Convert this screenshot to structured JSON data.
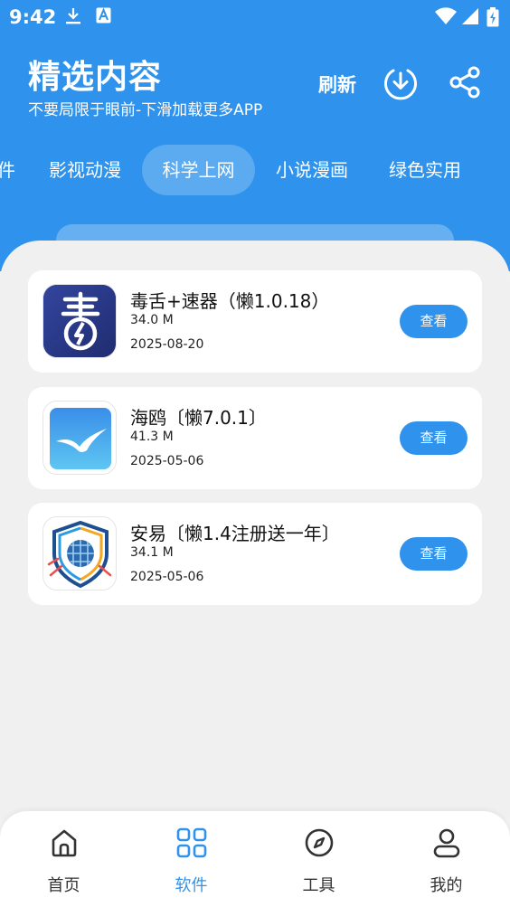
{
  "status_bar": {
    "time": "9:42"
  },
  "header": {
    "title": "精选内容",
    "subtitle": "不要局限于眼前-下滑加载更多APP",
    "refresh_label": "刷新"
  },
  "tabs": [
    {
      "label": "件"
    },
    {
      "label": "影视动漫"
    },
    {
      "label": "科学上网",
      "active": true
    },
    {
      "label": "小说漫画"
    },
    {
      "label": "绿色实用"
    }
  ],
  "apps": [
    {
      "name": "毒舌+速器（懒1.0.18）",
      "size": "34.0 M",
      "date": "2025-08-20",
      "button": "查看",
      "icon": "dushe-logo-icon"
    },
    {
      "name": "海鸥〔懒7.0.1〕",
      "size": "41.3 M",
      "date": "2025-05-06",
      "button": "查看",
      "icon": "seagull-icon"
    },
    {
      "name": "安易〔懒1.4注册送一年〕",
      "size": "34.1 M",
      "date": "2025-05-06",
      "button": "查看",
      "icon": "shield-globe-icon"
    }
  ],
  "bottom_nav": [
    {
      "label": "首页",
      "icon": "home-icon"
    },
    {
      "label": "软件",
      "icon": "grid-icon",
      "active": true
    },
    {
      "label": "工具",
      "icon": "compass-icon"
    },
    {
      "label": "我的",
      "icon": "user-icon"
    }
  ],
  "colors": {
    "primary": "#2f92ec",
    "background": "#f0f0f0"
  }
}
